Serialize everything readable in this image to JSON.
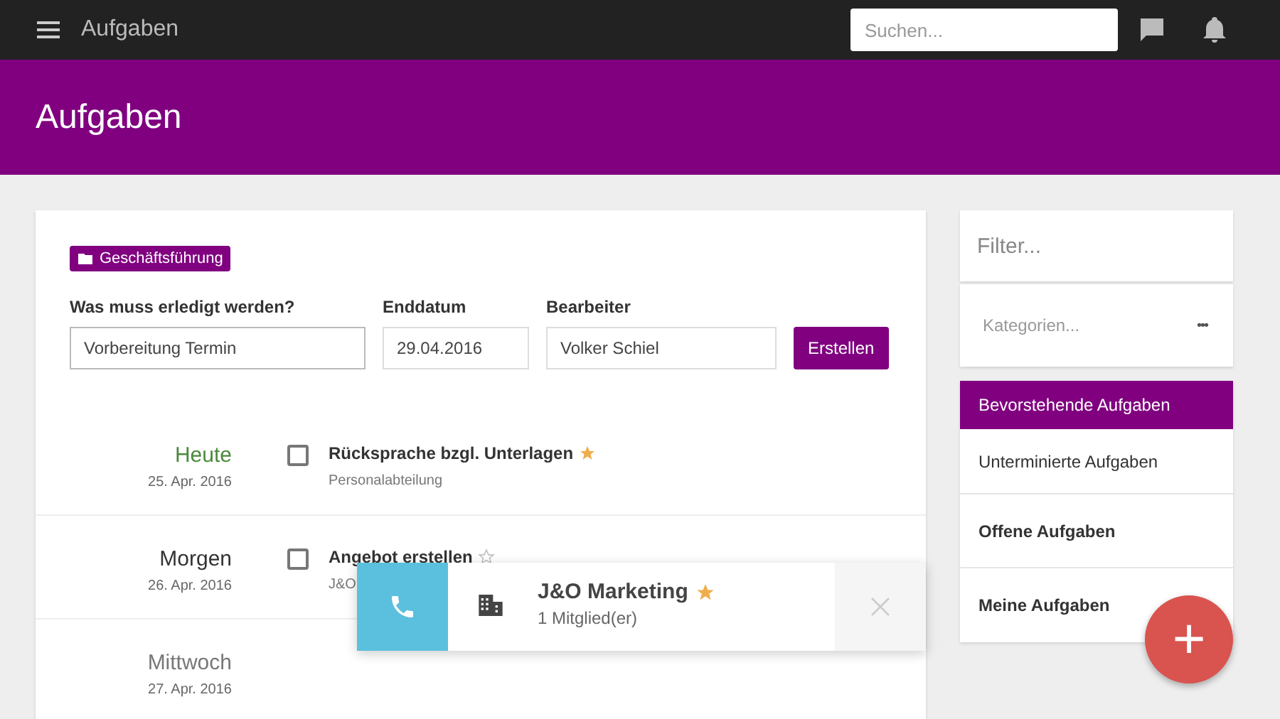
{
  "topbar": {
    "title": "Aufgaben",
    "search": {
      "placeholder": "Suchen..."
    }
  },
  "header": {
    "title": "Aufgaben"
  },
  "form": {
    "category": "Geschäftsführung",
    "fields": [
      {
        "label": "Was muss erledigt werden?",
        "value": "Vorbereitung Termin"
      },
      {
        "label": "Enddatum",
        "value": "29.04.2016"
      },
      {
        "label": "Bearbeiter",
        "value": "Volker Schiel"
      }
    ],
    "button": "Erstellen"
  },
  "days": [
    {
      "kind": "today",
      "name": "Heute",
      "date": "25. Apr. 2016",
      "tasks": [
        {
          "title": "Rücksprache bzgl. Unterlagen",
          "subtitle": "Personalabteilung",
          "starred": true,
          "checked": false
        }
      ]
    },
    {
      "kind": "tomorrow",
      "name": "Morgen",
      "date": "26. Apr. 2016",
      "tasks": [
        {
          "title": "Angebot erstellen",
          "subtitle": "J&O",
          "starred": false,
          "checked": false
        }
      ]
    },
    {
      "kind": "later",
      "name": "Mittwoch",
      "date": "27. Apr. 2016"
    }
  ],
  "sidebar": {
    "filter_placeholder": "Filter...",
    "categories_placeholder": "Kategorien...",
    "more": "•••",
    "items": [
      {
        "kind": "filter",
        "label": "Bevorstehende Aufgaben",
        "selected": true
      },
      {
        "kind": "filter",
        "label": "Unterminierte Aufgaben",
        "selected": false
      },
      {
        "kind": "section",
        "label": "Offene Aufgaben",
        "selected": false
      },
      {
        "kind": "section",
        "label": "Meine Aufgaben",
        "selected": false
      }
    ]
  },
  "fab": "+",
  "popup": {
    "title": "J&O Marketing",
    "subtitle": "1 Mitglied(er)",
    "starred": true
  }
}
